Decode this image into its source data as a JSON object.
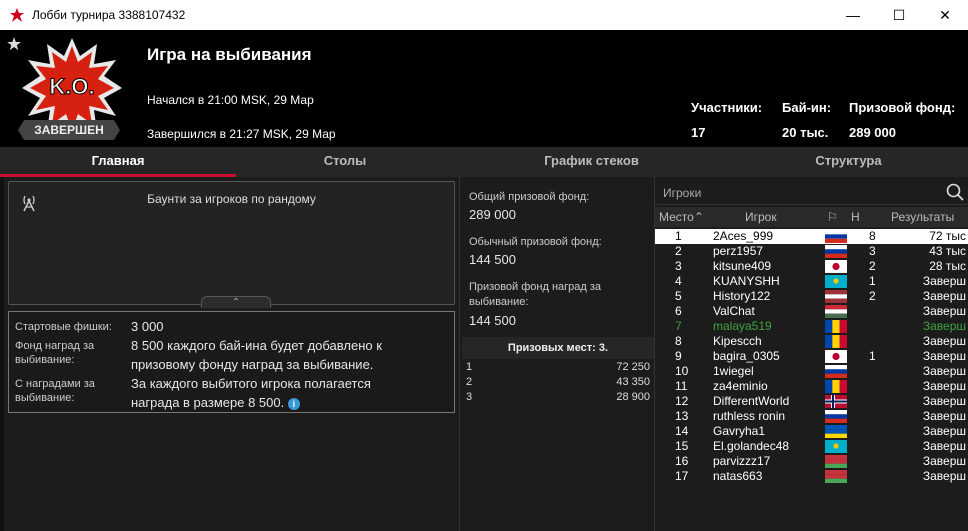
{
  "window": {
    "title": "Лобби турнира 3388107432"
  },
  "header": {
    "tournament_name": "Игра на выбивания",
    "status": "ЗАВЕРШЕН",
    "started": "Начался в 21:00 MSK, 29 Мар",
    "ended": "Завершился в 21:27 MSK, 29 Мар",
    "participants_label": "Участники:",
    "participants": "17",
    "buyin_label": "Бай-ин:",
    "buyin": "20 тыс.",
    "prizepool_label": "Призовой фонд:",
    "prizepool": "289 000",
    "logo_text": "K.O."
  },
  "tabs": [
    {
      "label": "Главная"
    },
    {
      "label": "Столы"
    },
    {
      "label": "График стеков"
    },
    {
      "label": "Структура"
    }
  ],
  "info": {
    "bounty_text": "Баунти за игроков по рандому",
    "starting_chips_label": "Стартовые фишки:",
    "starting_chips": "3 000",
    "bounty_fund_label_1": "Фонд наград за",
    "bounty_fund_label_2": "выбивание:",
    "bounty_fund_1": "8 500 каждого бай-ина будет добавлено к",
    "bounty_fund_2": "призовому фонду наград за выбивание.",
    "with_bounty_label_1": "С наградами за",
    "with_bounty_label_2": "выбивание:",
    "with_bounty_1": "За каждого выбитого игрока полагается",
    "with_bounty_2": "награда в размере 8 500."
  },
  "prizes": {
    "total_label": "Общий призовой фонд:",
    "total": "289 000",
    "regular_label": "Обычный призовой фонд:",
    "regular": "144 500",
    "bounty_label_1": "Призовой фонд наград за",
    "bounty_label_2": "выбивание:",
    "bounty": "144 500",
    "places_header": "Призовых мест: 3.",
    "rows": [
      {
        "place": "1",
        "value": "72 250"
      },
      {
        "place": "2",
        "value": "43 350"
      },
      {
        "place": "3",
        "value": "28 900"
      }
    ]
  },
  "players": {
    "search_placeholder": "Игроки",
    "col_place": "Место",
    "col_player": "Игрок",
    "col_knock": "Н",
    "col_results": "Результаты",
    "rows": [
      {
        "place": "1",
        "name": "2Aces_999",
        "flag": "ru",
        "knock": "8",
        "result": "72 тыс"
      },
      {
        "place": "2",
        "name": "perz1957",
        "flag": "ru",
        "knock": "3",
        "result": "43 тыс"
      },
      {
        "place": "3",
        "name": "kitsune409",
        "flag": "jp",
        "knock": "2",
        "result": "28 тыс"
      },
      {
        "place": "4",
        "name": "KUANYSHH",
        "flag": "kz",
        "knock": "1",
        "result": "Заверш"
      },
      {
        "place": "5",
        "name": "History122",
        "flag": "lv",
        "knock": "2",
        "result": "Заверш"
      },
      {
        "place": "6",
        "name": "ValChat",
        "flag": "hu",
        "knock": "",
        "result": "Заверш"
      },
      {
        "place": "7",
        "name": "malaya519",
        "flag": "md",
        "knock": "",
        "result": "Заверш",
        "green": true
      },
      {
        "place": "8",
        "name": "Kipescch",
        "flag": "md",
        "knock": "",
        "result": "Заверш"
      },
      {
        "place": "9",
        "name": "bagira_0305",
        "flag": "jp",
        "knock": "1",
        "result": "Заверш"
      },
      {
        "place": "10",
        "name": "1wiegel",
        "flag": "ru",
        "knock": "",
        "result": "Заверш"
      },
      {
        "place": "11",
        "name": "za4eminio",
        "flag": "ro",
        "knock": "",
        "result": "Заверш"
      },
      {
        "place": "12",
        "name": "DifferentWorld",
        "flag": "no",
        "knock": "",
        "result": "Заверш"
      },
      {
        "place": "13",
        "name": "ruthless ronin",
        "flag": "ru",
        "knock": "",
        "result": "Заверш"
      },
      {
        "place": "14",
        "name": "Gavryha1",
        "flag": "ua",
        "knock": "",
        "result": "Заверш"
      },
      {
        "place": "15",
        "name": "El.golandec48",
        "flag": "kz",
        "knock": "",
        "result": "Заверш"
      },
      {
        "place": "16",
        "name": "parvizzz17",
        "flag": "by",
        "knock": "",
        "result": "Заверш"
      },
      {
        "place": "17",
        "name": "natas663",
        "flag": "by",
        "knock": "",
        "result": "Заверш"
      }
    ]
  },
  "colors": {
    "accent": "#c8102e",
    "info_icon": "#3a9ad9",
    "green_text": "#3ea33e"
  }
}
